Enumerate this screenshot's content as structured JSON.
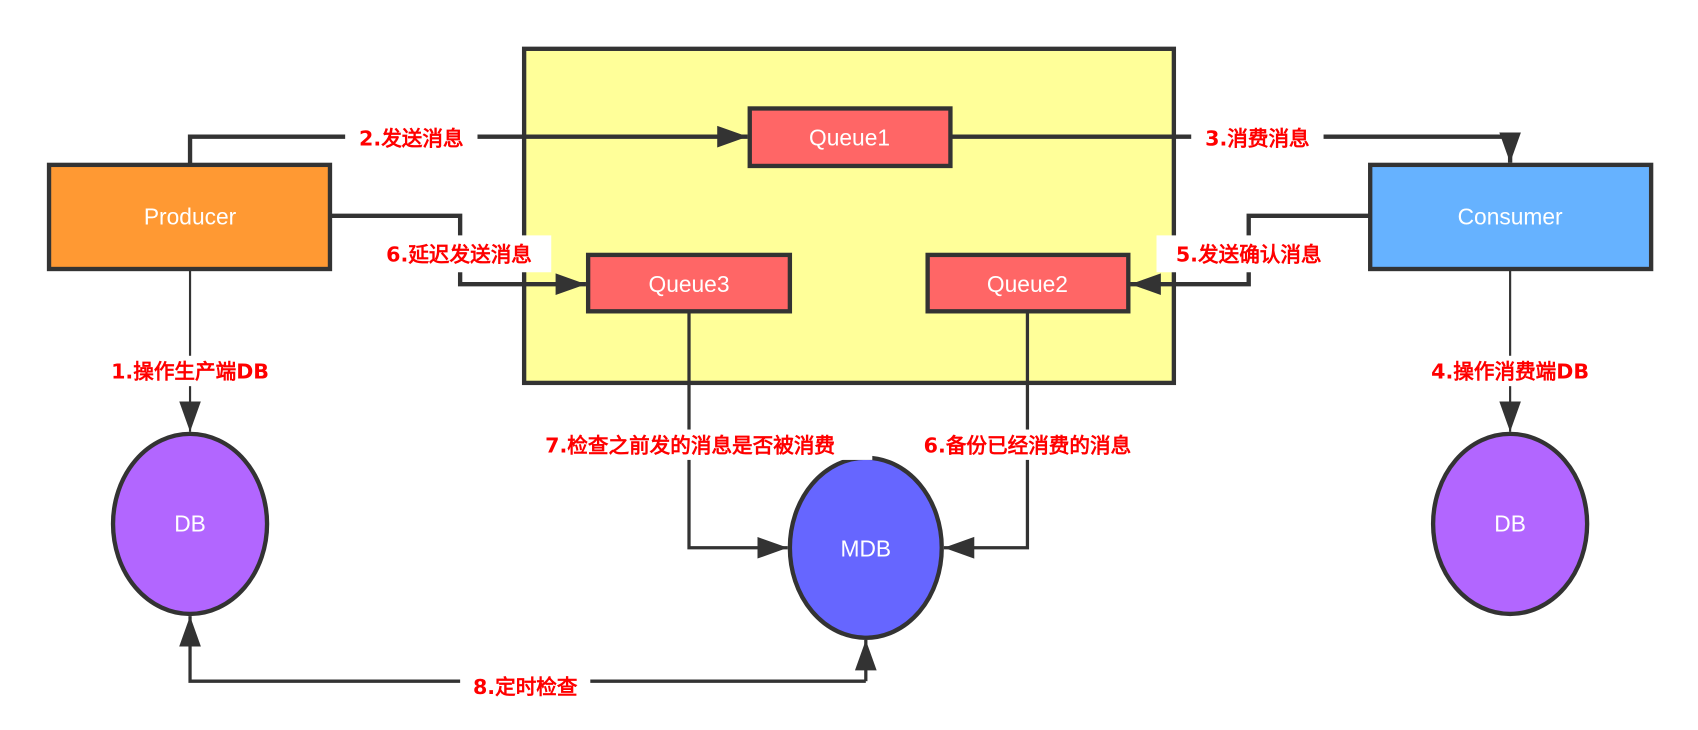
{
  "colors": {
    "container": "#FFFF99",
    "producer": "#FF9933",
    "consumer": "#66B2FF",
    "queue": "#FF6666",
    "db": "#B266FF",
    "mdb": "#6666FF",
    "label": "#FF0000",
    "stroke": "#333333"
  },
  "nodes": {
    "producer": "Producer",
    "consumer": "Consumer",
    "queue1": "Queue1",
    "queue2": "Queue2",
    "queue3": "Queue3",
    "db_producer": "DB",
    "db_consumer": "DB",
    "mdb": "MDB"
  },
  "edges": {
    "e1": "1.操作生产端DB",
    "e2": "2.发送消息",
    "e3": "3.消费消息",
    "e4": "4.操作消费端DB",
    "e5": "5.发送确认消息",
    "e6_delay": "6.延迟发送消息",
    "e6_backup": "6.备份已经消费的消息",
    "e7": "7.检查之前发的消息是否被消费",
    "e8": "8.定时检查"
  }
}
